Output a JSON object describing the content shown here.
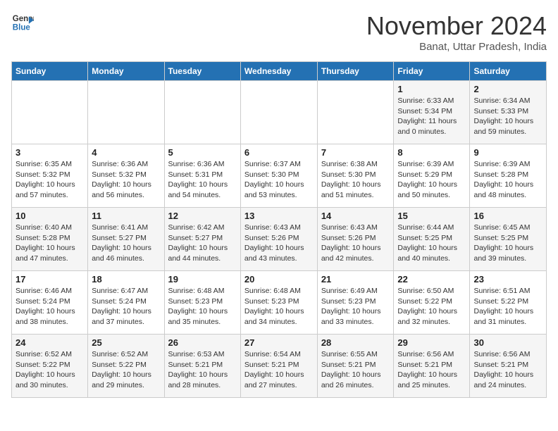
{
  "header": {
    "logo_line1": "General",
    "logo_line2": "Blue",
    "month": "November 2024",
    "location": "Banat, Uttar Pradesh, India"
  },
  "weekdays": [
    "Sunday",
    "Monday",
    "Tuesday",
    "Wednesday",
    "Thursday",
    "Friday",
    "Saturday"
  ],
  "weeks": [
    [
      {
        "day": "",
        "info": ""
      },
      {
        "day": "",
        "info": ""
      },
      {
        "day": "",
        "info": ""
      },
      {
        "day": "",
        "info": ""
      },
      {
        "day": "",
        "info": ""
      },
      {
        "day": "1",
        "info": "Sunrise: 6:33 AM\nSunset: 5:34 PM\nDaylight: 11 hours and 0 minutes."
      },
      {
        "day": "2",
        "info": "Sunrise: 6:34 AM\nSunset: 5:33 PM\nDaylight: 10 hours and 59 minutes."
      }
    ],
    [
      {
        "day": "3",
        "info": "Sunrise: 6:35 AM\nSunset: 5:32 PM\nDaylight: 10 hours and 57 minutes."
      },
      {
        "day": "4",
        "info": "Sunrise: 6:36 AM\nSunset: 5:32 PM\nDaylight: 10 hours and 56 minutes."
      },
      {
        "day": "5",
        "info": "Sunrise: 6:36 AM\nSunset: 5:31 PM\nDaylight: 10 hours and 54 minutes."
      },
      {
        "day": "6",
        "info": "Sunrise: 6:37 AM\nSunset: 5:30 PM\nDaylight: 10 hours and 53 minutes."
      },
      {
        "day": "7",
        "info": "Sunrise: 6:38 AM\nSunset: 5:30 PM\nDaylight: 10 hours and 51 minutes."
      },
      {
        "day": "8",
        "info": "Sunrise: 6:39 AM\nSunset: 5:29 PM\nDaylight: 10 hours and 50 minutes."
      },
      {
        "day": "9",
        "info": "Sunrise: 6:39 AM\nSunset: 5:28 PM\nDaylight: 10 hours and 48 minutes."
      }
    ],
    [
      {
        "day": "10",
        "info": "Sunrise: 6:40 AM\nSunset: 5:28 PM\nDaylight: 10 hours and 47 minutes."
      },
      {
        "day": "11",
        "info": "Sunrise: 6:41 AM\nSunset: 5:27 PM\nDaylight: 10 hours and 46 minutes."
      },
      {
        "day": "12",
        "info": "Sunrise: 6:42 AM\nSunset: 5:27 PM\nDaylight: 10 hours and 44 minutes."
      },
      {
        "day": "13",
        "info": "Sunrise: 6:43 AM\nSunset: 5:26 PM\nDaylight: 10 hours and 43 minutes."
      },
      {
        "day": "14",
        "info": "Sunrise: 6:43 AM\nSunset: 5:26 PM\nDaylight: 10 hours and 42 minutes."
      },
      {
        "day": "15",
        "info": "Sunrise: 6:44 AM\nSunset: 5:25 PM\nDaylight: 10 hours and 40 minutes."
      },
      {
        "day": "16",
        "info": "Sunrise: 6:45 AM\nSunset: 5:25 PM\nDaylight: 10 hours and 39 minutes."
      }
    ],
    [
      {
        "day": "17",
        "info": "Sunrise: 6:46 AM\nSunset: 5:24 PM\nDaylight: 10 hours and 38 minutes."
      },
      {
        "day": "18",
        "info": "Sunrise: 6:47 AM\nSunset: 5:24 PM\nDaylight: 10 hours and 37 minutes."
      },
      {
        "day": "19",
        "info": "Sunrise: 6:48 AM\nSunset: 5:23 PM\nDaylight: 10 hours and 35 minutes."
      },
      {
        "day": "20",
        "info": "Sunrise: 6:48 AM\nSunset: 5:23 PM\nDaylight: 10 hours and 34 minutes."
      },
      {
        "day": "21",
        "info": "Sunrise: 6:49 AM\nSunset: 5:23 PM\nDaylight: 10 hours and 33 minutes."
      },
      {
        "day": "22",
        "info": "Sunrise: 6:50 AM\nSunset: 5:22 PM\nDaylight: 10 hours and 32 minutes."
      },
      {
        "day": "23",
        "info": "Sunrise: 6:51 AM\nSunset: 5:22 PM\nDaylight: 10 hours and 31 minutes."
      }
    ],
    [
      {
        "day": "24",
        "info": "Sunrise: 6:52 AM\nSunset: 5:22 PM\nDaylight: 10 hours and 30 minutes."
      },
      {
        "day": "25",
        "info": "Sunrise: 6:52 AM\nSunset: 5:22 PM\nDaylight: 10 hours and 29 minutes."
      },
      {
        "day": "26",
        "info": "Sunrise: 6:53 AM\nSunset: 5:21 PM\nDaylight: 10 hours and 28 minutes."
      },
      {
        "day": "27",
        "info": "Sunrise: 6:54 AM\nSunset: 5:21 PM\nDaylight: 10 hours and 27 minutes."
      },
      {
        "day": "28",
        "info": "Sunrise: 6:55 AM\nSunset: 5:21 PM\nDaylight: 10 hours and 26 minutes."
      },
      {
        "day": "29",
        "info": "Sunrise: 6:56 AM\nSunset: 5:21 PM\nDaylight: 10 hours and 25 minutes."
      },
      {
        "day": "30",
        "info": "Sunrise: 6:56 AM\nSunset: 5:21 PM\nDaylight: 10 hours and 24 minutes."
      }
    ]
  ]
}
